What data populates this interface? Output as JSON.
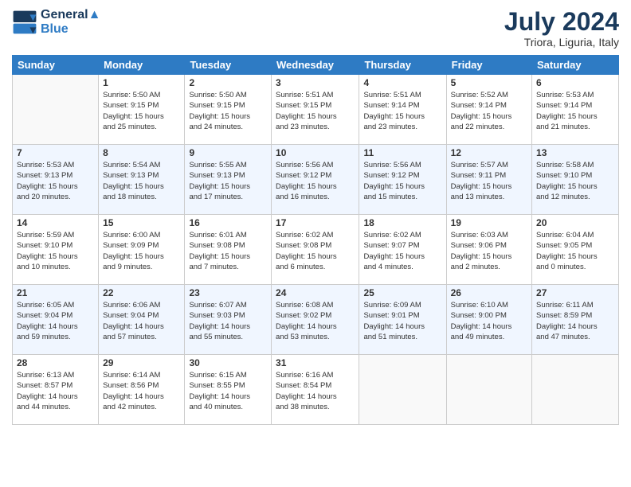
{
  "logo": {
    "line1": "General",
    "line2": "Blue"
  },
  "title": "July 2024",
  "location": "Triora, Liguria, Italy",
  "weekdays": [
    "Sunday",
    "Monday",
    "Tuesday",
    "Wednesday",
    "Thursday",
    "Friday",
    "Saturday"
  ],
  "weeks": [
    [
      {
        "num": "",
        "info": ""
      },
      {
        "num": "1",
        "info": "Sunrise: 5:50 AM\nSunset: 9:15 PM\nDaylight: 15 hours\nand 25 minutes."
      },
      {
        "num": "2",
        "info": "Sunrise: 5:50 AM\nSunset: 9:15 PM\nDaylight: 15 hours\nand 24 minutes."
      },
      {
        "num": "3",
        "info": "Sunrise: 5:51 AM\nSunset: 9:15 PM\nDaylight: 15 hours\nand 23 minutes."
      },
      {
        "num": "4",
        "info": "Sunrise: 5:51 AM\nSunset: 9:14 PM\nDaylight: 15 hours\nand 23 minutes."
      },
      {
        "num": "5",
        "info": "Sunrise: 5:52 AM\nSunset: 9:14 PM\nDaylight: 15 hours\nand 22 minutes."
      },
      {
        "num": "6",
        "info": "Sunrise: 5:53 AM\nSunset: 9:14 PM\nDaylight: 15 hours\nand 21 minutes."
      }
    ],
    [
      {
        "num": "7",
        "info": "Sunrise: 5:53 AM\nSunset: 9:13 PM\nDaylight: 15 hours\nand 20 minutes."
      },
      {
        "num": "8",
        "info": "Sunrise: 5:54 AM\nSunset: 9:13 PM\nDaylight: 15 hours\nand 18 minutes."
      },
      {
        "num": "9",
        "info": "Sunrise: 5:55 AM\nSunset: 9:13 PM\nDaylight: 15 hours\nand 17 minutes."
      },
      {
        "num": "10",
        "info": "Sunrise: 5:56 AM\nSunset: 9:12 PM\nDaylight: 15 hours\nand 16 minutes."
      },
      {
        "num": "11",
        "info": "Sunrise: 5:56 AM\nSunset: 9:12 PM\nDaylight: 15 hours\nand 15 minutes."
      },
      {
        "num": "12",
        "info": "Sunrise: 5:57 AM\nSunset: 9:11 PM\nDaylight: 15 hours\nand 13 minutes."
      },
      {
        "num": "13",
        "info": "Sunrise: 5:58 AM\nSunset: 9:10 PM\nDaylight: 15 hours\nand 12 minutes."
      }
    ],
    [
      {
        "num": "14",
        "info": "Sunrise: 5:59 AM\nSunset: 9:10 PM\nDaylight: 15 hours\nand 10 minutes."
      },
      {
        "num": "15",
        "info": "Sunrise: 6:00 AM\nSunset: 9:09 PM\nDaylight: 15 hours\nand 9 minutes."
      },
      {
        "num": "16",
        "info": "Sunrise: 6:01 AM\nSunset: 9:08 PM\nDaylight: 15 hours\nand 7 minutes."
      },
      {
        "num": "17",
        "info": "Sunrise: 6:02 AM\nSunset: 9:08 PM\nDaylight: 15 hours\nand 6 minutes."
      },
      {
        "num": "18",
        "info": "Sunrise: 6:02 AM\nSunset: 9:07 PM\nDaylight: 15 hours\nand 4 minutes."
      },
      {
        "num": "19",
        "info": "Sunrise: 6:03 AM\nSunset: 9:06 PM\nDaylight: 15 hours\nand 2 minutes."
      },
      {
        "num": "20",
        "info": "Sunrise: 6:04 AM\nSunset: 9:05 PM\nDaylight: 15 hours\nand 0 minutes."
      }
    ],
    [
      {
        "num": "21",
        "info": "Sunrise: 6:05 AM\nSunset: 9:04 PM\nDaylight: 14 hours\nand 59 minutes."
      },
      {
        "num": "22",
        "info": "Sunrise: 6:06 AM\nSunset: 9:04 PM\nDaylight: 14 hours\nand 57 minutes."
      },
      {
        "num": "23",
        "info": "Sunrise: 6:07 AM\nSunset: 9:03 PM\nDaylight: 14 hours\nand 55 minutes."
      },
      {
        "num": "24",
        "info": "Sunrise: 6:08 AM\nSunset: 9:02 PM\nDaylight: 14 hours\nand 53 minutes."
      },
      {
        "num": "25",
        "info": "Sunrise: 6:09 AM\nSunset: 9:01 PM\nDaylight: 14 hours\nand 51 minutes."
      },
      {
        "num": "26",
        "info": "Sunrise: 6:10 AM\nSunset: 9:00 PM\nDaylight: 14 hours\nand 49 minutes."
      },
      {
        "num": "27",
        "info": "Sunrise: 6:11 AM\nSunset: 8:59 PM\nDaylight: 14 hours\nand 47 minutes."
      }
    ],
    [
      {
        "num": "28",
        "info": "Sunrise: 6:13 AM\nSunset: 8:57 PM\nDaylight: 14 hours\nand 44 minutes."
      },
      {
        "num": "29",
        "info": "Sunrise: 6:14 AM\nSunset: 8:56 PM\nDaylight: 14 hours\nand 42 minutes."
      },
      {
        "num": "30",
        "info": "Sunrise: 6:15 AM\nSunset: 8:55 PM\nDaylight: 14 hours\nand 40 minutes."
      },
      {
        "num": "31",
        "info": "Sunrise: 6:16 AM\nSunset: 8:54 PM\nDaylight: 14 hours\nand 38 minutes."
      },
      {
        "num": "",
        "info": ""
      },
      {
        "num": "",
        "info": ""
      },
      {
        "num": "",
        "info": ""
      }
    ]
  ]
}
